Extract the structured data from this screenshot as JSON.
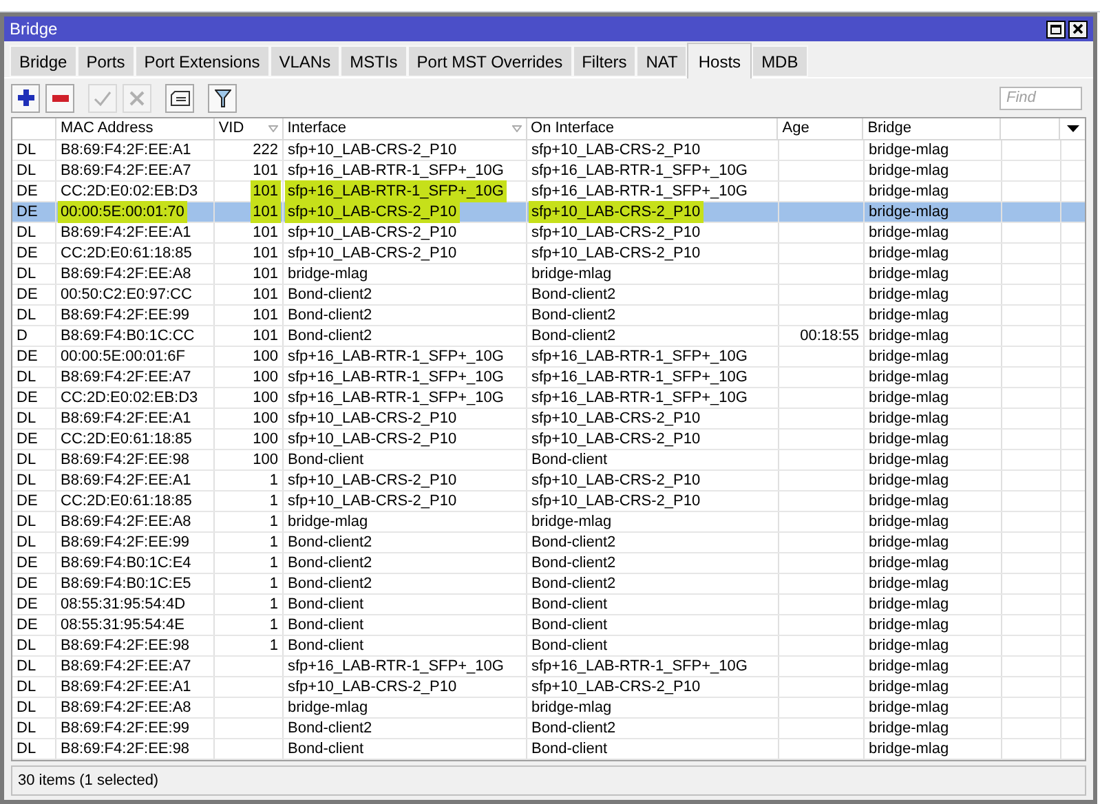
{
  "window": {
    "title": "Bridge"
  },
  "tabs": [
    {
      "label": "Bridge",
      "selected": false
    },
    {
      "label": "Ports",
      "selected": false
    },
    {
      "label": "Port Extensions",
      "selected": false
    },
    {
      "label": "VLANs",
      "selected": false
    },
    {
      "label": "MSTIs",
      "selected": false
    },
    {
      "label": "Port MST Overrides",
      "selected": false
    },
    {
      "label": "Filters",
      "selected": false
    },
    {
      "label": "NAT",
      "selected": false
    },
    {
      "label": "Hosts",
      "selected": true
    },
    {
      "label": "MDB",
      "selected": false
    }
  ],
  "toolbar": {
    "buttons": [
      {
        "kind": "add",
        "disabled": false
      },
      {
        "kind": "remove",
        "disabled": false
      },
      {
        "kind": "enable",
        "disabled": true
      },
      {
        "kind": "disable",
        "disabled": true
      },
      {
        "kind": "comment",
        "disabled": false
      },
      {
        "kind": "filter",
        "disabled": false
      }
    ],
    "search": {
      "placeholder": "Find"
    }
  },
  "table": {
    "columns": [
      "MAC Address",
      "VID",
      "Interface",
      "On Interface",
      "Age",
      "Bridge"
    ],
    "rows": [
      {
        "flags": "DL",
        "mac": "B8:69:F4:2F:EE:A1",
        "vid": "222",
        "interface": "sfp+10_LAB-CRS-2_P10",
        "on_interface": "sfp+10_LAB-CRS-2_P10",
        "bridge": "bridge-mlag",
        "selected": false
      },
      {
        "flags": "DL",
        "mac": "B8:69:F4:2F:EE:A7",
        "vid": "101",
        "interface": "sfp+16_LAB-RTR-1_SFP+_10G",
        "on_interface": "sfp+16_LAB-RTR-1_SFP+_10G",
        "bridge": "bridge-mlag",
        "selected": false
      },
      {
        "flags": "DE",
        "mac": "CC:2D:E0:02:EB:D3",
        "vid": "101",
        "interface": "sfp+16_LAB-RTR-1_SFP+_10G",
        "on_interface": "sfp+16_LAB-RTR-1_SFP+_10G",
        "bridge": "bridge-mlag",
        "selected": false,
        "vid_highlighted": true,
        "interface_highlighted": true
      },
      {
        "flags": "DE",
        "mac": "00:00:5E:00:01:70",
        "vid": "101",
        "interface": "sfp+10_LAB-CRS-2_P10",
        "on_interface": "sfp+10_LAB-CRS-2_P10",
        "bridge": "bridge-mlag",
        "selected": true,
        "mac_highlighted": true,
        "vid_highlighted": true,
        "interface_highlighted": true,
        "on_interface_highlighted": true
      },
      {
        "flags": "DL",
        "mac": "B8:69:F4:2F:EE:A1",
        "vid": "101",
        "interface": "sfp+10_LAB-CRS-2_P10",
        "on_interface": "sfp+10_LAB-CRS-2_P10",
        "bridge": "bridge-mlag",
        "selected": false
      },
      {
        "flags": "DE",
        "mac": "CC:2D:E0:61:18:85",
        "vid": "101",
        "interface": "sfp+10_LAB-CRS-2_P10",
        "on_interface": "sfp+10_LAB-CRS-2_P10",
        "bridge": "bridge-mlag",
        "selected": false
      },
      {
        "flags": "DL",
        "mac": "B8:69:F4:2F:EE:A8",
        "vid": "101",
        "interface": "bridge-mlag",
        "on_interface": "bridge-mlag",
        "bridge": "bridge-mlag",
        "selected": false
      },
      {
        "flags": "DE",
        "mac": "00:50:C2:E0:97:CC",
        "vid": "101",
        "interface": "Bond-client2",
        "on_interface": "Bond-client2",
        "bridge": "bridge-mlag",
        "selected": false
      },
      {
        "flags": "DL",
        "mac": "B8:69:F4:2F:EE:99",
        "vid": "101",
        "interface": "Bond-client2",
        "on_interface": "Bond-client2",
        "bridge": "bridge-mlag",
        "selected": false
      },
      {
        "flags": "D",
        "mac": "B8:69:F4:B0:1C:CC",
        "vid": "101",
        "interface": "Bond-client2",
        "on_interface": "Bond-client2",
        "age": "00:18:55",
        "bridge": "bridge-mlag",
        "selected": false
      },
      {
        "flags": "DE",
        "mac": "00:00:5E:00:01:6F",
        "vid": "100",
        "interface": "sfp+16_LAB-RTR-1_SFP+_10G",
        "on_interface": "sfp+16_LAB-RTR-1_SFP+_10G",
        "bridge": "bridge-mlag",
        "selected": false
      },
      {
        "flags": "DL",
        "mac": "B8:69:F4:2F:EE:A7",
        "vid": "100",
        "interface": "sfp+16_LAB-RTR-1_SFP+_10G",
        "on_interface": "sfp+16_LAB-RTR-1_SFP+_10G",
        "bridge": "bridge-mlag",
        "selected": false
      },
      {
        "flags": "DE",
        "mac": "CC:2D:E0:02:EB:D3",
        "vid": "100",
        "interface": "sfp+16_LAB-RTR-1_SFP+_10G",
        "on_interface": "sfp+16_LAB-RTR-1_SFP+_10G",
        "bridge": "bridge-mlag",
        "selected": false
      },
      {
        "flags": "DL",
        "mac": "B8:69:F4:2F:EE:A1",
        "vid": "100",
        "interface": "sfp+10_LAB-CRS-2_P10",
        "on_interface": "sfp+10_LAB-CRS-2_P10",
        "bridge": "bridge-mlag",
        "selected": false
      },
      {
        "flags": "DE",
        "mac": "CC:2D:E0:61:18:85",
        "vid": "100",
        "interface": "sfp+10_LAB-CRS-2_P10",
        "on_interface": "sfp+10_LAB-CRS-2_P10",
        "bridge": "bridge-mlag",
        "selected": false
      },
      {
        "flags": "DL",
        "mac": "B8:69:F4:2F:EE:98",
        "vid": "100",
        "interface": "Bond-client",
        "on_interface": "Bond-client",
        "bridge": "bridge-mlag",
        "selected": false
      },
      {
        "flags": "DL",
        "mac": "B8:69:F4:2F:EE:A1",
        "vid": "1",
        "interface": "sfp+10_LAB-CRS-2_P10",
        "on_interface": "sfp+10_LAB-CRS-2_P10",
        "bridge": "bridge-mlag",
        "selected": false
      },
      {
        "flags": "DE",
        "mac": "CC:2D:E0:61:18:85",
        "vid": "1",
        "interface": "sfp+10_LAB-CRS-2_P10",
        "on_interface": "sfp+10_LAB-CRS-2_P10",
        "bridge": "bridge-mlag",
        "selected": false
      },
      {
        "flags": "DL",
        "mac": "B8:69:F4:2F:EE:A8",
        "vid": "1",
        "interface": "bridge-mlag",
        "on_interface": "bridge-mlag",
        "bridge": "bridge-mlag",
        "selected": false
      },
      {
        "flags": "DL",
        "mac": "B8:69:F4:2F:EE:99",
        "vid": "1",
        "interface": "Bond-client2",
        "on_interface": "Bond-client2",
        "bridge": "bridge-mlag",
        "selected": false
      },
      {
        "flags": "DE",
        "mac": "B8:69:F4:B0:1C:E4",
        "vid": "1",
        "interface": "Bond-client2",
        "on_interface": "Bond-client2",
        "bridge": "bridge-mlag",
        "selected": false
      },
      {
        "flags": "DE",
        "mac": "B8:69:F4:B0:1C:E5",
        "vid": "1",
        "interface": "Bond-client2",
        "on_interface": "Bond-client2",
        "bridge": "bridge-mlag",
        "selected": false
      },
      {
        "flags": "DE",
        "mac": "08:55:31:95:54:4D",
        "vid": "1",
        "interface": "Bond-client",
        "on_interface": "Bond-client",
        "bridge": "bridge-mlag",
        "selected": false
      },
      {
        "flags": "DE",
        "mac": "08:55:31:95:54:4E",
        "vid": "1",
        "interface": "Bond-client",
        "on_interface": "Bond-client",
        "bridge": "bridge-mlag",
        "selected": false
      },
      {
        "flags": "DL",
        "mac": "B8:69:F4:2F:EE:98",
        "vid": "1",
        "interface": "Bond-client",
        "on_interface": "Bond-client",
        "bridge": "bridge-mlag",
        "selected": false
      },
      {
        "flags": "DL",
        "mac": "B8:69:F4:2F:EE:A7",
        "interface": "sfp+16_LAB-RTR-1_SFP+_10G",
        "on_interface": "sfp+16_LAB-RTR-1_SFP+_10G",
        "bridge": "bridge-mlag",
        "selected": false
      },
      {
        "flags": "DL",
        "mac": "B8:69:F4:2F:EE:A1",
        "interface": "sfp+10_LAB-CRS-2_P10",
        "on_interface": "sfp+10_LAB-CRS-2_P10",
        "bridge": "bridge-mlag",
        "selected": false
      },
      {
        "flags": "DL",
        "mac": "B8:69:F4:2F:EE:A8",
        "interface": "bridge-mlag",
        "on_interface": "bridge-mlag",
        "bridge": "bridge-mlag",
        "selected": false
      },
      {
        "flags": "DL",
        "mac": "B8:69:F4:2F:EE:99",
        "interface": "Bond-client2",
        "on_interface": "Bond-client2",
        "bridge": "bridge-mlag",
        "selected": false
      },
      {
        "flags": "DL",
        "mac": "B8:69:F4:2F:EE:98",
        "interface": "Bond-client",
        "on_interface": "Bond-client",
        "bridge": "bridge-mlag",
        "selected": false
      }
    ]
  },
  "status_bar": "30 items (1 selected)"
}
